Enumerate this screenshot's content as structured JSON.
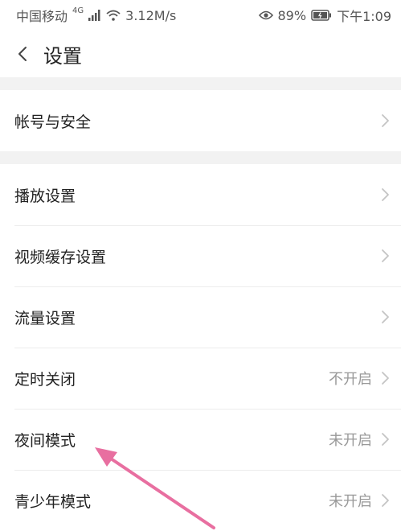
{
  "status_bar": {
    "carrier": "中国移动",
    "network": "4G",
    "speed": "3.12M/s",
    "battery": "89%",
    "time": "下午1:09"
  },
  "header": {
    "title": "设置"
  },
  "sections": [
    {
      "items": [
        {
          "label": "帐号与安全",
          "value": ""
        }
      ]
    },
    {
      "items": [
        {
          "label": "播放设置",
          "value": ""
        },
        {
          "label": "视频缓存设置",
          "value": ""
        },
        {
          "label": "流量设置",
          "value": ""
        },
        {
          "label": "定时关闭",
          "value": "不开启"
        },
        {
          "label": "夜间模式",
          "value": "未开启"
        },
        {
          "label": "青少年模式",
          "value": "未开启"
        }
      ]
    }
  ],
  "colors": {
    "annotation_arrow": "#e86fa0",
    "section_divider": "#f2f2f2",
    "secondary_text": "#999999"
  }
}
